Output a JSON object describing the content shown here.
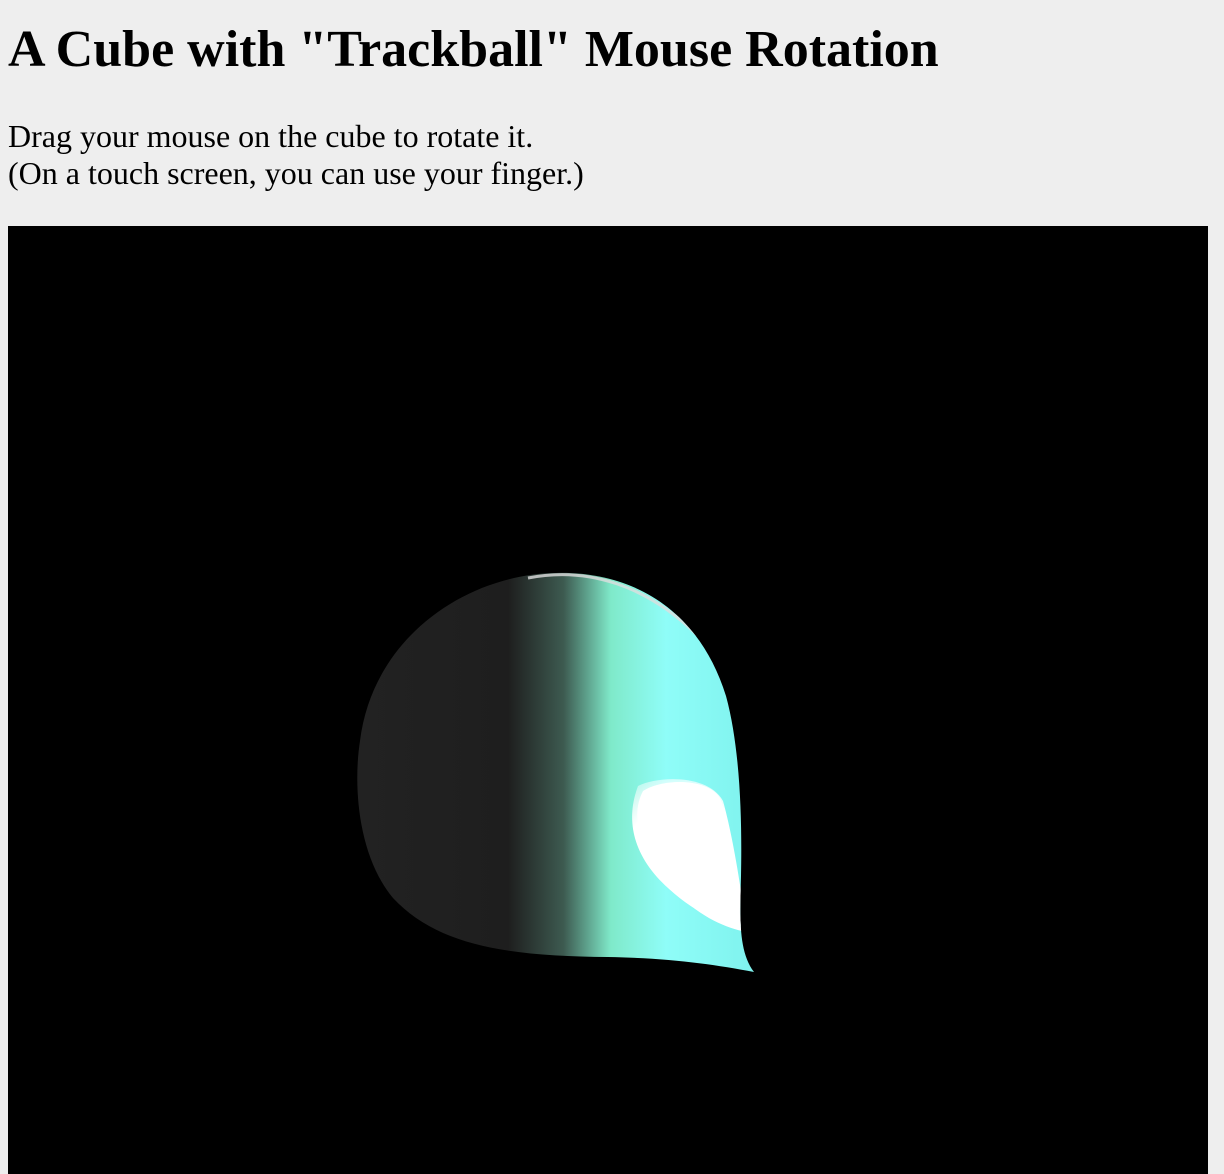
{
  "page": {
    "title": "A Cube with \"Trackball\" Mouse Rotation",
    "instructions": {
      "line1": "Drag your mouse on the cube to rotate it.",
      "line2": "(On a touch screen, you can use your finger.)"
    }
  },
  "scene": {
    "background_color": "#000000",
    "object_colors": {
      "shadow": "#1e1e1e",
      "mid": "#7fe9c9",
      "lit": "#8ffdf8",
      "highlight": "#ffffff"
    }
  }
}
